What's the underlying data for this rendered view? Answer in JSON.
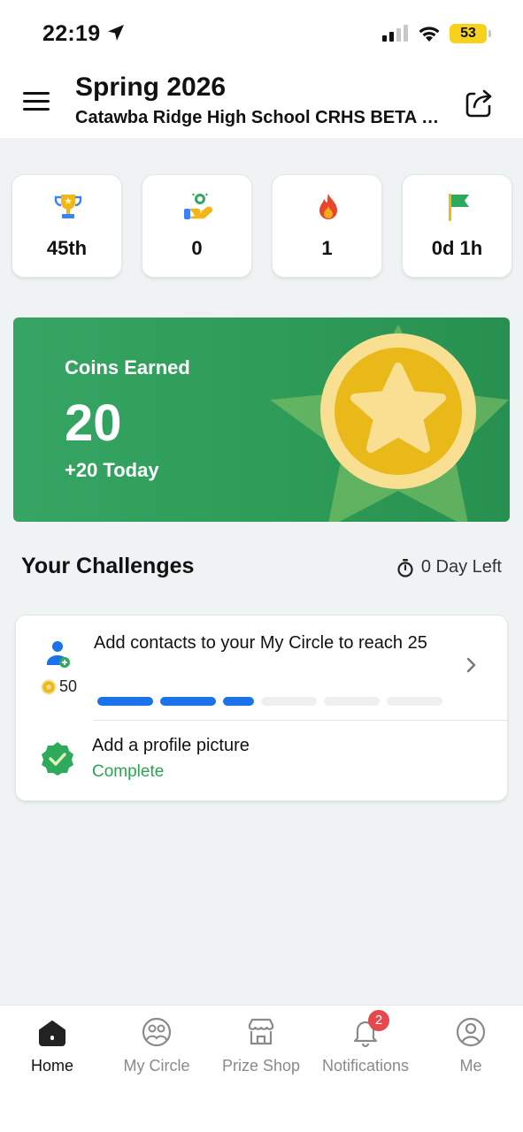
{
  "status_bar": {
    "time": "22:19",
    "battery": "53"
  },
  "header": {
    "title": "Spring 2026",
    "subtitle": "Catawba Ridge High School CRHS BETA Club"
  },
  "stats": [
    {
      "icon": "trophy-icon",
      "value": "45th"
    },
    {
      "icon": "hand-coin-icon",
      "value": "0"
    },
    {
      "icon": "flame-icon",
      "value": "1"
    },
    {
      "icon": "flag-icon",
      "value": "0d 1h"
    }
  ],
  "coins": {
    "label": "Coins Earned",
    "value": "20",
    "today": "+20 Today"
  },
  "challenges": {
    "title": "Your Challenges",
    "time_left": "0 Day Left",
    "items": [
      {
        "text": "Add contacts to your My Circle to reach 25",
        "reward": "50",
        "progress_filled": 3,
        "progress_total": 6
      },
      {
        "text": "Add a profile picture",
        "status": "Complete"
      }
    ]
  },
  "tabs": [
    {
      "label": "Home",
      "active": true
    },
    {
      "label": "My Circle"
    },
    {
      "label": "Prize Shop"
    },
    {
      "label": "Notifications",
      "badge": "2"
    },
    {
      "label": "Me"
    }
  ],
  "colors": {
    "accent_green": "#2e9a57",
    "primary_blue": "#1a73e8",
    "coin_gold": "#e9b819",
    "badge_red": "#e5484d"
  }
}
